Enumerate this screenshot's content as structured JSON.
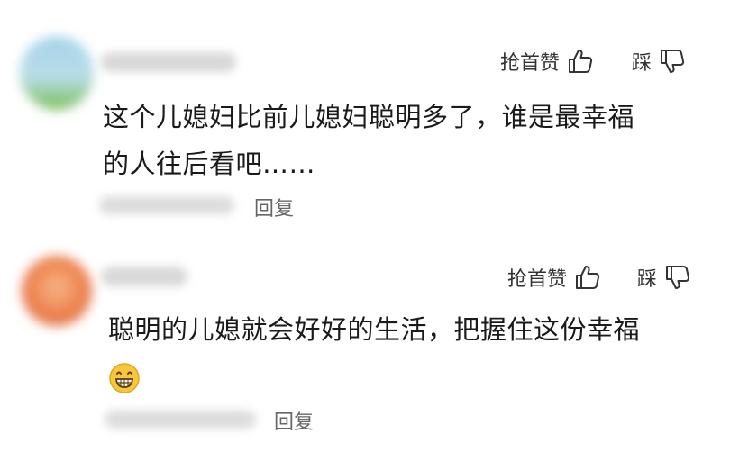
{
  "comments": [
    {
      "like_label": "抢首赞",
      "dislike_label": "踩",
      "text_line1": "这个儿媳妇比前儿媳妇聪明多了，谁是最幸福",
      "text_line2": "的人往后看吧……",
      "reply_label": "回复",
      "avatar_color_top": "#a7d3ea",
      "avatar_color_bottom": "#7bbf5a"
    },
    {
      "like_label": "抢首赞",
      "dislike_label": "踩",
      "text_line1": "聪明的儿媳就会好好的生活，把握住这份幸福",
      "reply_label": "回复",
      "avatar_color_top": "#f2a068",
      "avatar_color_bottom": "#d9583a",
      "emoji": "grinning-face-emoji"
    }
  ],
  "colors": {
    "text": "#1a1a1a",
    "secondary": "#666666",
    "background": "#ffffff"
  }
}
